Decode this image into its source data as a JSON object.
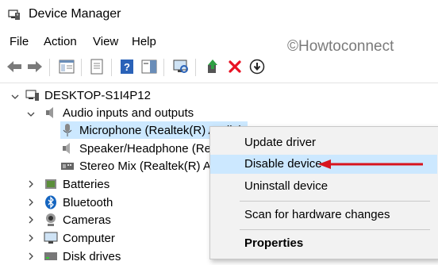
{
  "window": {
    "title": "Device Manager"
  },
  "menu": {
    "items": [
      "File",
      "Action",
      "View",
      "Help"
    ]
  },
  "watermark": "©Howtoconnect",
  "tree": {
    "root": "DESKTOP-S1I4P12",
    "audio_category": "Audio inputs and outputs",
    "audio_devices": [
      "Microphone (Realtek(R) Audio)",
      "Speaker/Headphone (Realtek(R) Audio)",
      "Stereo Mix (Realtek(R) Audio)"
    ],
    "categories": [
      "Batteries",
      "Bluetooth",
      "Cameras",
      "Computer",
      "Disk drives"
    ]
  },
  "context_menu": {
    "update_driver": "Update driver",
    "disable_device": "Disable device",
    "uninstall_device": "Uninstall device",
    "scan_hardware": "Scan for hardware changes",
    "properties": "Properties"
  },
  "colors": {
    "selection": "#cce8ff",
    "arrow": "#d8141e",
    "accent": "#0078d7"
  }
}
